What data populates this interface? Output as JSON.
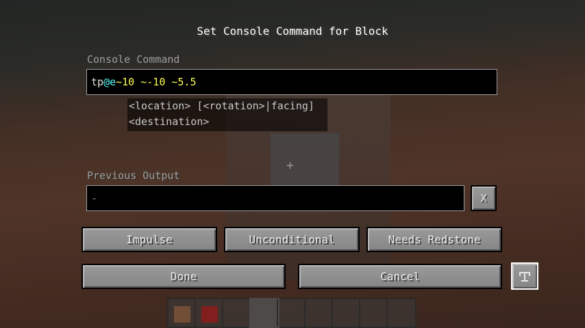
{
  "title": "Set Console Command for Block",
  "command": {
    "label": "Console Command",
    "tokens": {
      "cmd": "tp",
      "selector": "@e",
      "coords": "~10 ~-10 ~5.5"
    }
  },
  "suggestions": [
    "<location> [<rotation>|facing]",
    "<destination>"
  ],
  "previous_output": {
    "label": "Previous Output",
    "value": "-",
    "clear_label": "X"
  },
  "mode_buttons": {
    "impulse": "Impulse",
    "conditional": "Unconditional",
    "redstone": "Needs Redstone"
  },
  "actions": {
    "done": "Done",
    "cancel": "Cancel"
  },
  "track_output_icon": "track-output-toggle-icon",
  "hotbar": {
    "slots": 9,
    "selected_slot": 4
  }
}
